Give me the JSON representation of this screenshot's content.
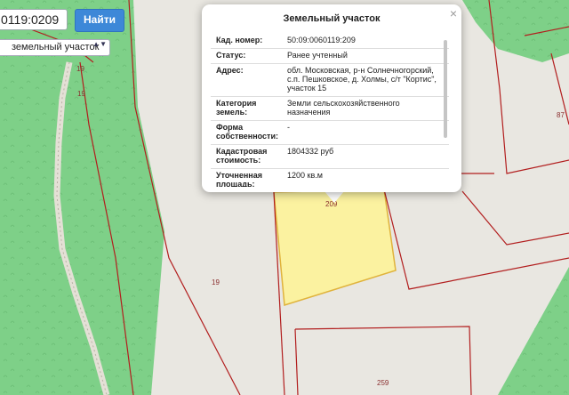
{
  "search": {
    "value": "0119:0209",
    "button_label": "Найти"
  },
  "type_select": {
    "value": "земельный участок",
    "arrows": "▲▼"
  },
  "map_labels": {
    "label_19_top": "19",
    "label_19_mid": "19",
    "label_19_low": "19",
    "label_209": "209",
    "label_87": "87",
    "label_259": "259"
  },
  "popup": {
    "title": "Земельный участок",
    "close": "×",
    "rows": [
      {
        "label": "Кад. номер:",
        "value": "50:09:0060119:209"
      },
      {
        "label": "Статус:",
        "value": "Ранее учтенный"
      },
      {
        "label": "Адрес:",
        "value": "обл. Московская, р-н Солнечногорский, с.п. Пешковское, д. Холмы, с/т \"Кортис\", участок 15"
      },
      {
        "label": "Категория земель:",
        "value": "Земли сельскохозяйственного назначения"
      },
      {
        "label": "Форма собственности:",
        "value": "-"
      },
      {
        "label": "Кадастровая стоимость:",
        "value": "1804332 руб"
      },
      {
        "label": "Уточненная площадь:",
        "value": "1200 кв.м"
      }
    ]
  },
  "colors": {
    "forest": "#7ed088",
    "background": "#e9e7e1",
    "parcel_fill": "#fbf2a0",
    "parcel_border": "#e0b33c",
    "boundary": "#b21e1e",
    "path": "#e4e0d6",
    "button": "#3d88d8"
  }
}
